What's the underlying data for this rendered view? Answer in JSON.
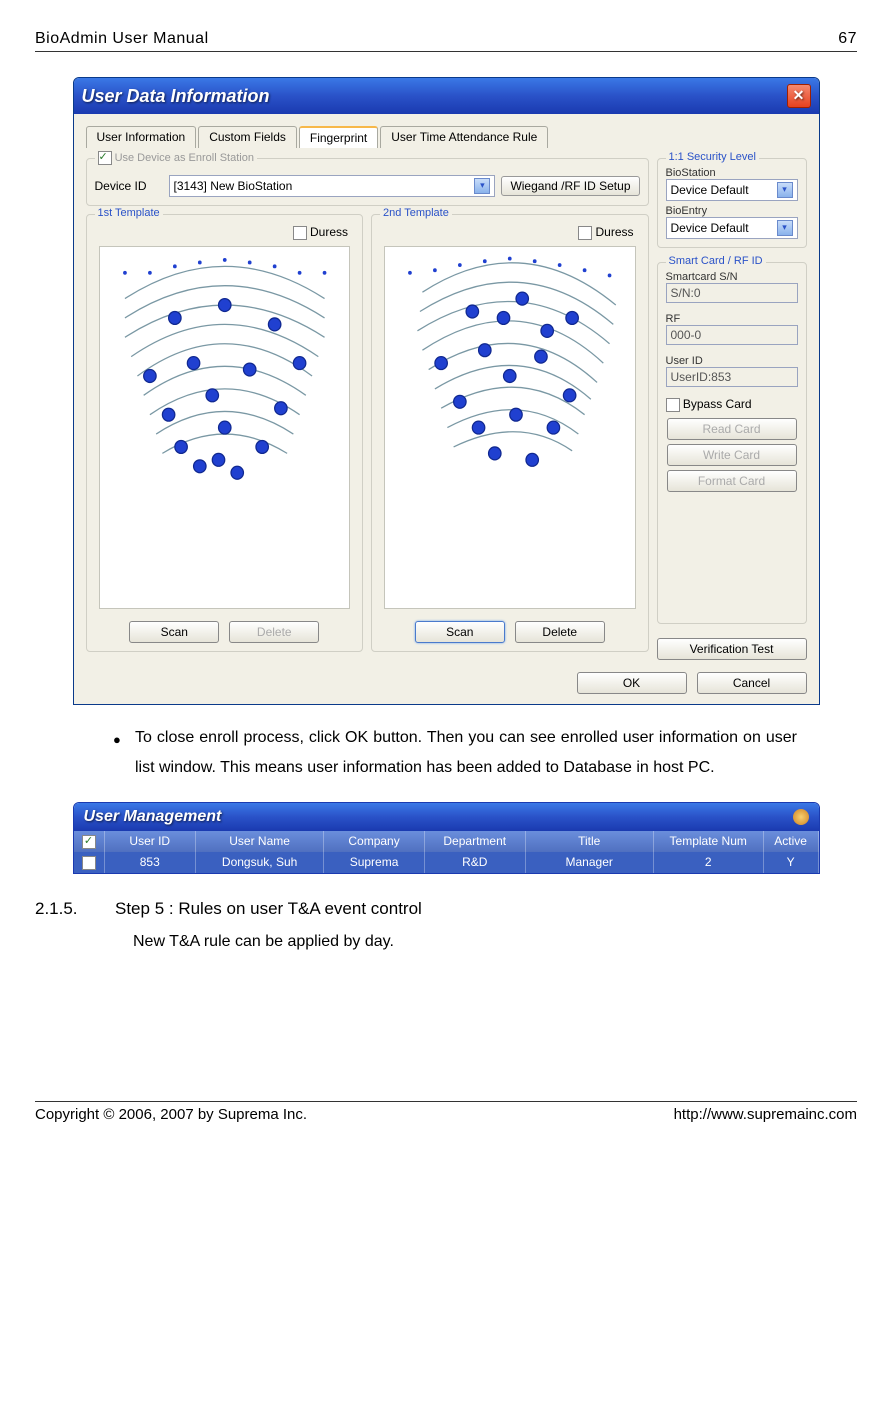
{
  "doc_header": {
    "left": "BioAdmin User Manual",
    "right": "67"
  },
  "dialog": {
    "title": "User Data Information",
    "tabs": [
      "User Information",
      "Custom Fields",
      "Fingerprint",
      "User Time Attendance Rule"
    ],
    "active_tab": 2,
    "enroll": {
      "legend": "Use Device as Enroll Station",
      "device_id_label": "Device ID",
      "device_value": "[3143] New BioStation",
      "wiegand_button": "Wiegand /RF ID Setup"
    },
    "security": {
      "legend": "1:1 Security Level",
      "biostation_label": "BioStation",
      "biostation_value": "Device Default",
      "bioentry_label": "BioEntry",
      "bioentry_value": "Device Default"
    },
    "template1": {
      "legend": "1st Template",
      "duress": "Duress",
      "scan": "Scan",
      "delete": "Delete"
    },
    "template2": {
      "legend": "2nd Template",
      "duress": "Duress",
      "scan": "Scan",
      "delete": "Delete"
    },
    "smartcard": {
      "legend": "Smart Card / RF ID",
      "sn_label": "Smartcard S/N",
      "sn_value": "S/N:0",
      "rf_label": "RF",
      "rf_value": "000-0",
      "userid_label": "User ID",
      "userid_value": "UserID:853",
      "bypass": "Bypass Card",
      "read": "Read Card",
      "write": "Write Card",
      "format": "Format Card"
    },
    "verification_button": "Verification Test",
    "ok": "OK",
    "cancel": "Cancel"
  },
  "bullet_text": "To close enroll process, click OK button. Then you can see enrolled user information on user list window. This means user information has been added to Database in host PC.",
  "user_mgmt": {
    "title": "User Management",
    "headers": {
      "user_id": "User ID",
      "user_name": "User Name",
      "company": "Company",
      "department": "Department",
      "title": "Title",
      "template_num": "Template Num",
      "active": "Active"
    },
    "row": {
      "user_id": "853",
      "user_name": "Dongsuk, Suh",
      "company": "Suprema",
      "department": "R&D",
      "title": "Manager",
      "template_num": "2",
      "active": "Y"
    }
  },
  "section": {
    "num": "2.1.5.",
    "title": "Step 5 : Rules on user T&A event control",
    "body": "New T&A rule can be applied by day."
  },
  "doc_footer": {
    "left": "Copyright © 2006, 2007 by Suprema Inc.",
    "right": "http://www.supremainc.com"
  }
}
